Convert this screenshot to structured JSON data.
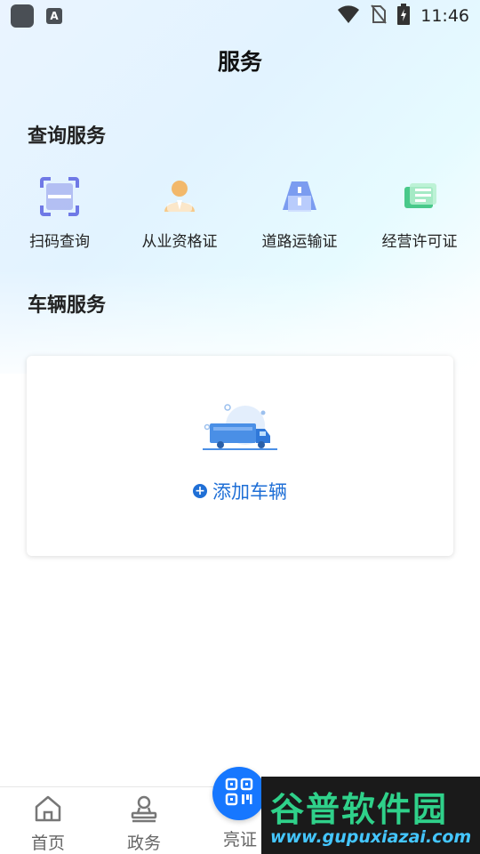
{
  "status_bar": {
    "time": "11:46",
    "icons": [
      "app-icon",
      "font-icon",
      "wifi-icon",
      "no-sim-icon",
      "battery-charging-icon"
    ],
    "font_icon_glyph": "A"
  },
  "header": {
    "title": "服务"
  },
  "query_services": {
    "title": "查询服务",
    "items": [
      {
        "label": "扫码查询",
        "icon": "scan-query-icon"
      },
      {
        "label": "从业资格证",
        "icon": "qualification-cert-icon"
      },
      {
        "label": "道路运输证",
        "icon": "road-transport-cert-icon"
      },
      {
        "label": "经营许可证",
        "icon": "business-license-icon"
      }
    ]
  },
  "vehicle_services": {
    "title": "车辆服务",
    "add_label": "添加车辆",
    "add_symbol": "+"
  },
  "bottom_nav": {
    "items": [
      {
        "label": "首页",
        "icon": "home-icon"
      },
      {
        "label": "政务",
        "icon": "government-icon"
      },
      {
        "label": "亮证",
        "icon": "qr-code-icon"
      }
    ]
  },
  "watermark": {
    "big_text": "谷普软件园",
    "small_text": "www.gupuxiazai.com"
  },
  "colors": {
    "accent": "#1677ff",
    "link": "#1f6fd6",
    "watermark_green": "#2fd18a",
    "watermark_blue": "#44c6ff"
  }
}
